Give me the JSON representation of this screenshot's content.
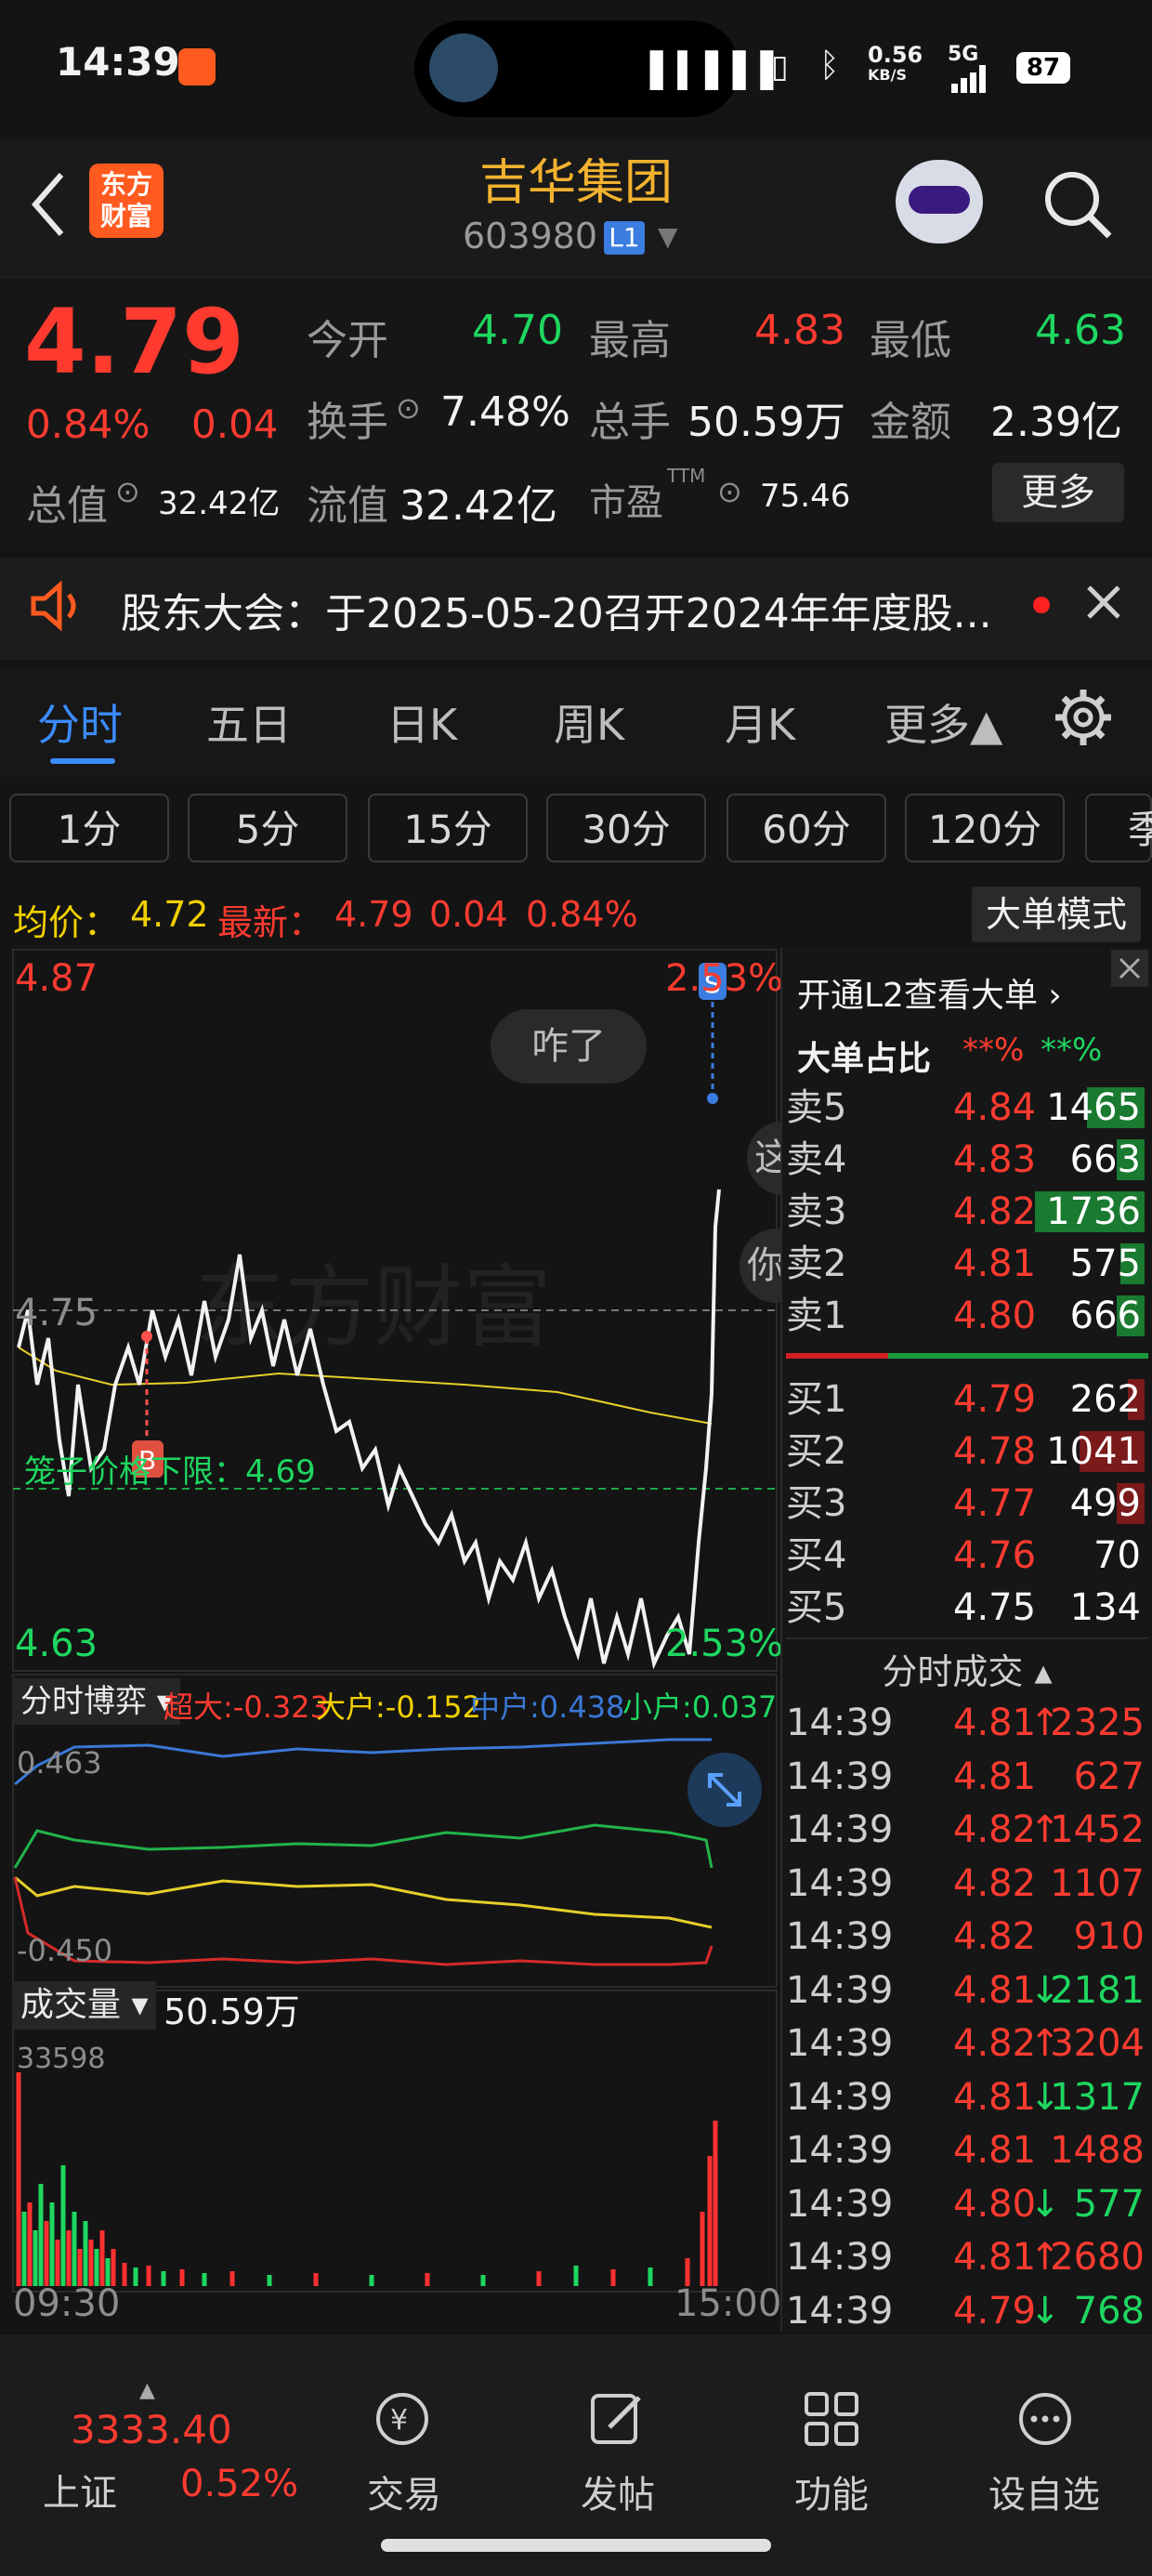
{
  "status": {
    "time": "14:39",
    "net_speed": "0.56",
    "net_unit": "KB/S",
    "signal": "5G",
    "battery": "87"
  },
  "header": {
    "app_logo_text": "东方财富",
    "stock_name": "吉华集团",
    "stock_code": "603980",
    "level_badge": "L1"
  },
  "quote": {
    "price": "4.79",
    "change_pct": "0.84%",
    "change": "0.04",
    "open_label": "今开",
    "open": "4.70",
    "high_label": "最高",
    "high": "4.83",
    "low_label": "最低",
    "low": "4.63",
    "turnover_label": "换手",
    "turnover": "7.48%",
    "volume_label": "总手",
    "volume": "50.59万",
    "amount_label": "金额",
    "amount": "2.39亿",
    "mktcap_label": "总值",
    "mktcap": "32.42亿",
    "float_label": "流值",
    "float": "32.42亿",
    "pe_label": "市盈",
    "pe_sup": "TTM",
    "pe": "75.46",
    "more_button": "更多"
  },
  "notice": {
    "text": "股东大会：于2025-05-20召开2024年年度股..."
  },
  "tabs": [
    "分时",
    "五日",
    "日K",
    "周K",
    "月K",
    "更多▲"
  ],
  "periods": [
    "1分",
    "5分",
    "15分",
    "30分",
    "60分",
    "120分",
    "季"
  ],
  "intraday": {
    "avg_label": "均价：",
    "avg": "4.72",
    "latest_label": "最新：",
    "latest": "4.79",
    "latest_change": "0.04",
    "latest_pct": "0.84%",
    "big_order_button": "大单模式",
    "top_price": "4.87",
    "top_pct": "2.53%",
    "mid_price": "4.75",
    "bottom_price": "4.63",
    "bottom_pct": "2.53%",
    "yesterday_label": "咋了",
    "cage_label": "笼子价格下限：4.69",
    "watermark": "东方财富",
    "marker_s": "S",
    "marker_b": "B",
    "side_hint_1": "这",
    "side_hint_2": "你"
  },
  "game": {
    "selector": "分时博弈",
    "super_label": "超大:",
    "super": "-0.323",
    "big_label": "大户:",
    "big": "-0.152",
    "mid_label": "中户:",
    "mid": "0.438",
    "small_label": "小户:",
    "small": "0.037",
    "top_val": "0.463",
    "bottom_val": "-0.450"
  },
  "volume_panel": {
    "selector": "成交量",
    "total": "50.59万",
    "max": "33598",
    "start_time": "09:30",
    "end_time": "15:00"
  },
  "order_book": {
    "promo": "开通L2查看大单 ›",
    "ratio_label": "大单占比",
    "ratio_red": "**%",
    "ratio_green": "**%",
    "asks": [
      {
        "label": "卖5",
        "price": "4.84",
        "vol": "1465"
      },
      {
        "label": "卖4",
        "price": "4.83",
        "vol": "663"
      },
      {
        "label": "卖3",
        "price": "4.82",
        "vol": "1736"
      },
      {
        "label": "卖2",
        "price": "4.81",
        "vol": "575"
      },
      {
        "label": "卖1",
        "price": "4.80",
        "vol": "666"
      }
    ],
    "bids": [
      {
        "label": "买1",
        "price": "4.79",
        "vol": "262"
      },
      {
        "label": "买2",
        "price": "4.78",
        "vol": "1041"
      },
      {
        "label": "买3",
        "price": "4.77",
        "vol": "499"
      },
      {
        "label": "买4",
        "price": "4.76",
        "vol": "70"
      },
      {
        "label": "买5",
        "price": "4.75",
        "vol": "134"
      }
    ]
  },
  "trades": {
    "title": "分时成交",
    "rows": [
      {
        "time": "14:39",
        "price": "4.81",
        "dir": "↑",
        "vol": "2325",
        "color": "red"
      },
      {
        "time": "14:39",
        "price": "4.81",
        "dir": "",
        "vol": "627",
        "color": "red"
      },
      {
        "time": "14:39",
        "price": "4.82",
        "dir": "↑",
        "vol": "1452",
        "color": "red"
      },
      {
        "time": "14:39",
        "price": "4.82",
        "dir": "",
        "vol": "1107",
        "color": "red"
      },
      {
        "time": "14:39",
        "price": "4.82",
        "dir": "",
        "vol": "910",
        "color": "red"
      },
      {
        "time": "14:39",
        "price": "4.81",
        "dir": "↓",
        "vol": "2181",
        "color": "green"
      },
      {
        "time": "14:39",
        "price": "4.82",
        "dir": "↑",
        "vol": "3204",
        "color": "red"
      },
      {
        "time": "14:39",
        "price": "4.81",
        "dir": "↓",
        "vol": "1317",
        "color": "green"
      },
      {
        "time": "14:39",
        "price": "4.81",
        "dir": "",
        "vol": "1488",
        "color": "red"
      },
      {
        "time": "14:39",
        "price": "4.80",
        "dir": "↓",
        "vol": "577",
        "color": "green"
      },
      {
        "time": "14:39",
        "price": "4.81",
        "dir": "↑",
        "vol": "2680",
        "color": "red"
      },
      {
        "time": "14:39",
        "price": "4.79",
        "dir": "↓",
        "vol": "768",
        "color": "green"
      }
    ]
  },
  "bottom_nav": {
    "index_value": "3333.40",
    "index_name": "上证",
    "index_pct": "0.52%",
    "items": [
      "交易",
      "发帖",
      "功能",
      "设自选"
    ]
  },
  "colors": {
    "up": "#ff3b30",
    "down": "#1ed760",
    "avg_line": "#f0d000",
    "accent_blue": "#3b8cff"
  }
}
